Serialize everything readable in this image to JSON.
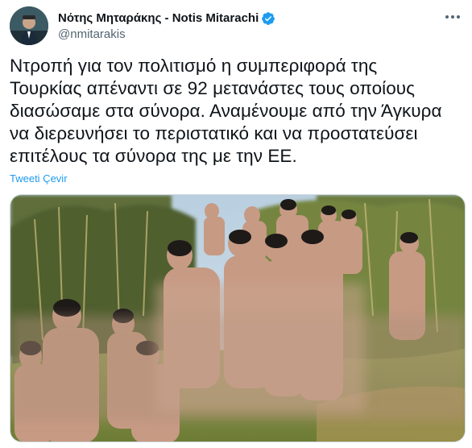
{
  "author": {
    "display_name": "Νότης Μηταράκης - Notis Mitarachi",
    "handle": "@nmitarakis",
    "verified": true,
    "avatar_icon": "profile-photo"
  },
  "tweet": {
    "text_lines": [
      "Ντροπή για τον πολιτισμό η συμπεριφορά της",
      "Τουρκίας απέναντι σε 92 μετανάστες τους οποίους",
      "διασώσαμε στα σύνορα. Αναμένουμε από την Άγκυρα",
      "να διερευνήσει το περιστατικό και να προστατεύσει",
      "επιτέλους τα σύνορα της με την ΕΕ."
    ],
    "translate_label": "Tweeti Çevir"
  },
  "colors": {
    "link": "#1d9bf0",
    "verified_badge": "#1d9bf0",
    "secondary_text": "#536471"
  }
}
